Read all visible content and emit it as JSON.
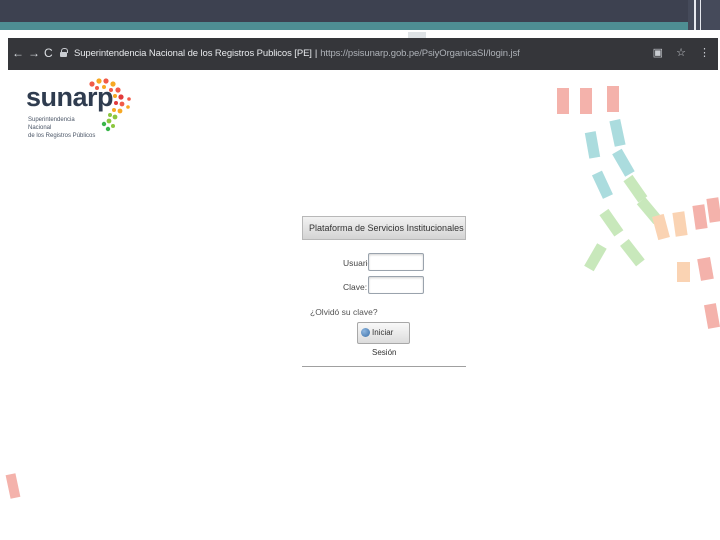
{
  "browser": {
    "nav_back": "←",
    "nav_forward": "→",
    "nav_reload": "C",
    "site_name": "Superintendencia Nacional de los Registros Publicos [PE]",
    "separator": "|",
    "url": "https://psisunarp.gob.pe/PsiyOrganicaSI/login.jsf",
    "icons": [
      "bookmark-page-icon",
      "star-icon",
      "menu-dots-icon"
    ]
  },
  "logo": {
    "name": "sunarp",
    "subtitle_line1": "Superintendencia Nacional",
    "subtitle_line2": "de los Registros Públicos"
  },
  "login": {
    "panel_title": "Plataforma de Servicios Institucionales",
    "user_label": "Usuario:",
    "user_value": "",
    "password_label": "Clave:",
    "password_value": "",
    "forgot_link": "¿Olvidó su clave?",
    "submit_label": "Iniciar Sesión"
  },
  "colors": {
    "slide_header": "#3d4150",
    "slide_accent": "#4e8e93",
    "browser_bar": "#35363a",
    "logo_text": "#2f3c4f",
    "tile_red": "#f0998f",
    "tile_teal": "#8fd0d3",
    "tile_green": "#b6e0a4",
    "tile_orange": "#f9c59a"
  }
}
